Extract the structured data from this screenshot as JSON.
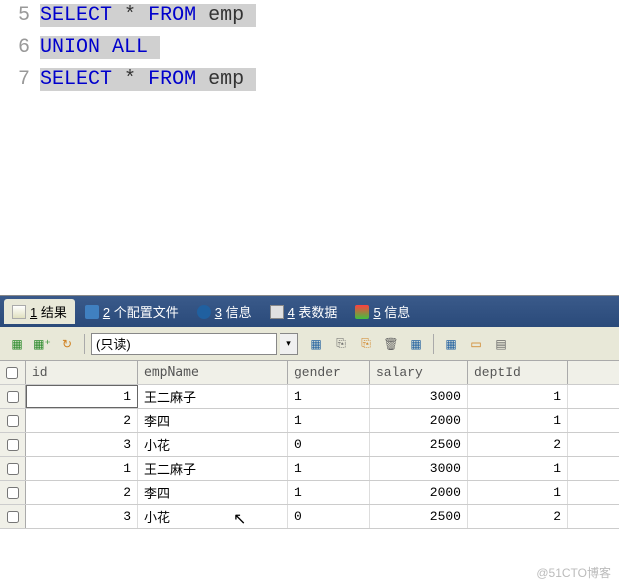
{
  "editor": {
    "lines": [
      {
        "num": "5",
        "tokens": [
          {
            "t": "SELECT",
            "c": "kw"
          },
          {
            "t": " ",
            "c": ""
          },
          {
            "t": "*",
            "c": "star"
          },
          {
            "t": " ",
            "c": ""
          },
          {
            "t": "FROM",
            "c": "kw"
          },
          {
            "t": " ",
            "c": ""
          },
          {
            "t": "emp",
            "c": "ident"
          }
        ],
        "selected": true
      },
      {
        "num": "6",
        "tokens": [
          {
            "t": "UNION ALL",
            "c": "kw"
          }
        ],
        "selected": true
      },
      {
        "num": "7",
        "tokens": [
          {
            "t": "SELECT",
            "c": "kw"
          },
          {
            "t": " ",
            "c": ""
          },
          {
            "t": "*",
            "c": "star"
          },
          {
            "t": " ",
            "c": ""
          },
          {
            "t": "FROM",
            "c": "kw"
          },
          {
            "t": " ",
            "c": ""
          },
          {
            "t": "emp",
            "c": "ident"
          }
        ],
        "selected": true
      }
    ]
  },
  "tabs": {
    "items": [
      {
        "num": "1",
        "label": "结果",
        "icon": "icon-result",
        "active": true
      },
      {
        "num": "2",
        "label": "个配置文件",
        "icon": "icon-profile",
        "active": false
      },
      {
        "num": "3",
        "label": "信息",
        "icon": "icon-info1",
        "active": false
      },
      {
        "num": "4",
        "label": "表数据",
        "icon": "icon-table",
        "active": false
      },
      {
        "num": "5",
        "label": "信息",
        "icon": "icon-info2",
        "active": false
      }
    ]
  },
  "toolbar": {
    "readonly_label": "(只读)"
  },
  "grid": {
    "columns": [
      "id",
      "empName",
      "gender",
      "salary",
      "deptId"
    ],
    "rows": [
      {
        "id": "1",
        "empName": "王二麻子",
        "gender": "1",
        "salary": "3000",
        "deptId": "1",
        "active": true
      },
      {
        "id": "2",
        "empName": "李四",
        "gender": "1",
        "salary": "2000",
        "deptId": "1",
        "active": false
      },
      {
        "id": "3",
        "empName": "小花",
        "gender": "0",
        "salary": "2500",
        "deptId": "2",
        "active": false
      },
      {
        "id": "1",
        "empName": "王二麻子",
        "gender": "1",
        "salary": "3000",
        "deptId": "1",
        "active": false
      },
      {
        "id": "2",
        "empName": "李四",
        "gender": "1",
        "salary": "2000",
        "deptId": "1",
        "active": false
      },
      {
        "id": "3",
        "empName": "小花",
        "gender": "0",
        "salary": "2500",
        "deptId": "2",
        "active": false
      }
    ]
  },
  "watermark": "@51CTO博客"
}
